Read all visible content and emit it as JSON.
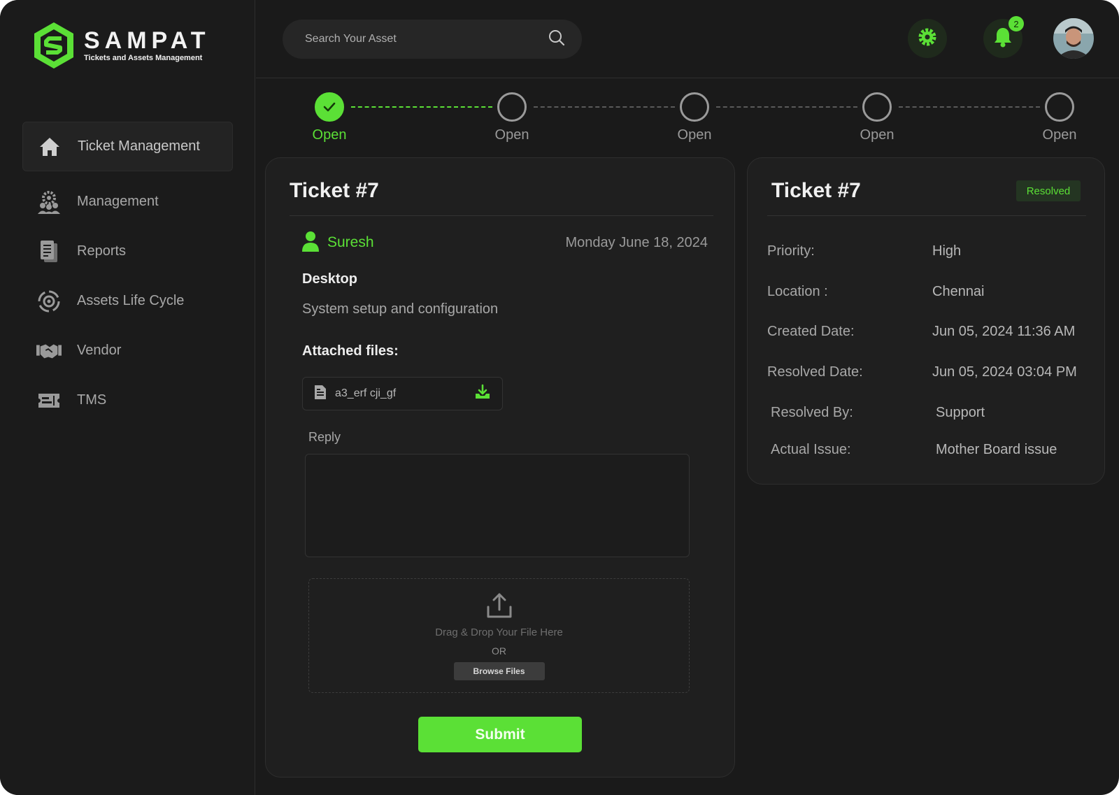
{
  "brand": {
    "title": "SAMPAT",
    "subtitle": "Tickets and Assets Management",
    "accent_color": "#5be036"
  },
  "sidebar": {
    "items": [
      {
        "label": "Ticket Management",
        "icon": "home-icon",
        "active": true
      },
      {
        "label": "Management",
        "icon": "team-gear-icon"
      },
      {
        "label": "Reports",
        "icon": "reports-icon"
      },
      {
        "label": "Assets Life Cycle",
        "icon": "lifecycle-icon"
      },
      {
        "label": "Vendor",
        "icon": "handshake-icon"
      },
      {
        "label": "TMS",
        "icon": "ticket-icon"
      }
    ]
  },
  "header": {
    "search_placeholder": "Search Your Asset",
    "notification_count": "2"
  },
  "stepper": {
    "steps": [
      {
        "label": "Open",
        "done": true
      },
      {
        "label": "Open",
        "done": false
      },
      {
        "label": "Open",
        "done": false
      },
      {
        "label": "Open",
        "done": false
      },
      {
        "label": "Open",
        "done": false
      }
    ]
  },
  "ticket": {
    "title": "Ticket #7",
    "user": "Suresh",
    "date": "Monday June 18, 2024",
    "subject": "Desktop",
    "description": "System setup and configuration",
    "attached_label": "Attached files:",
    "file_name": "a3_erf cji_gf",
    "reply_label": "Reply",
    "dropzone_text": "Drag & Drop Your File Here",
    "dropzone_or": "OR",
    "browse_label": "Browse Files",
    "submit_label": "Submit"
  },
  "details": {
    "title": "Ticket #7",
    "status": "Resolved",
    "rows": [
      {
        "key": "Priority:",
        "value": "High"
      },
      {
        "key": "Location :",
        "value": "Chennai"
      },
      {
        "key": "Created Date:",
        "value": "Jun 05, 2024 11:36 AM"
      },
      {
        "key": "Resolved Date:",
        "value": "Jun 05, 2024 03:04 PM"
      },
      {
        "key": "Resolved By:",
        "value": "Support"
      },
      {
        "key": "Actual Issue:",
        "value": "Mother Board issue"
      }
    ]
  }
}
